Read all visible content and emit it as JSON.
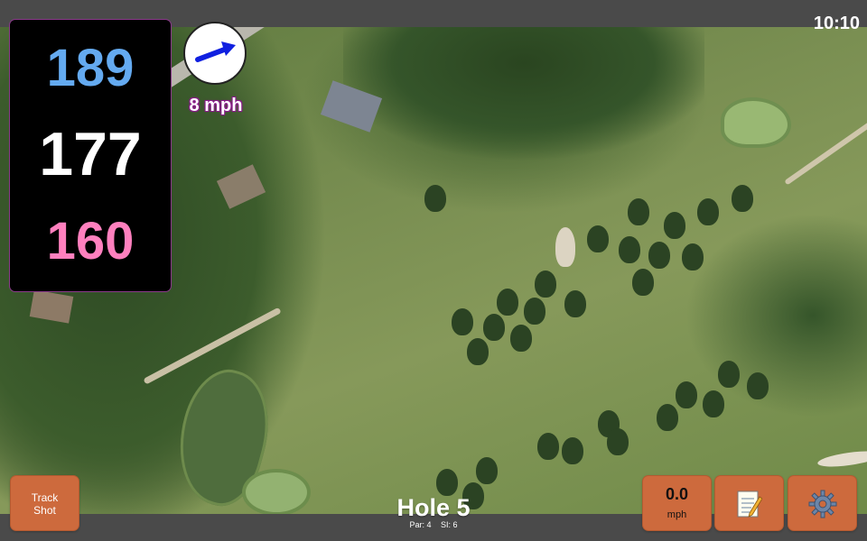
{
  "status": {
    "time": "10:10"
  },
  "yardages": {
    "back": "189",
    "middle": "177",
    "front": "160"
  },
  "wind": {
    "speed_label": "8 mph",
    "direction_icon": "wind-arrow-icon"
  },
  "hole": {
    "title": "Hole 5",
    "par_label": "Par: 4",
    "si_label": "SI: 6"
  },
  "buttons": {
    "track_shot_line1": "Track",
    "track_shot_line2": "Shot",
    "speed_value": "0.0",
    "speed_unit": "mph",
    "notes_icon": "notepad-icon",
    "settings_icon": "gear-icon"
  },
  "colors": {
    "back_yardage": "#64aaf0",
    "middle_yardage": "#ffffff",
    "front_yardage": "#ff80be",
    "button_bg": "#cd6a3d",
    "wind_label_outline": "#8a1a8a"
  }
}
